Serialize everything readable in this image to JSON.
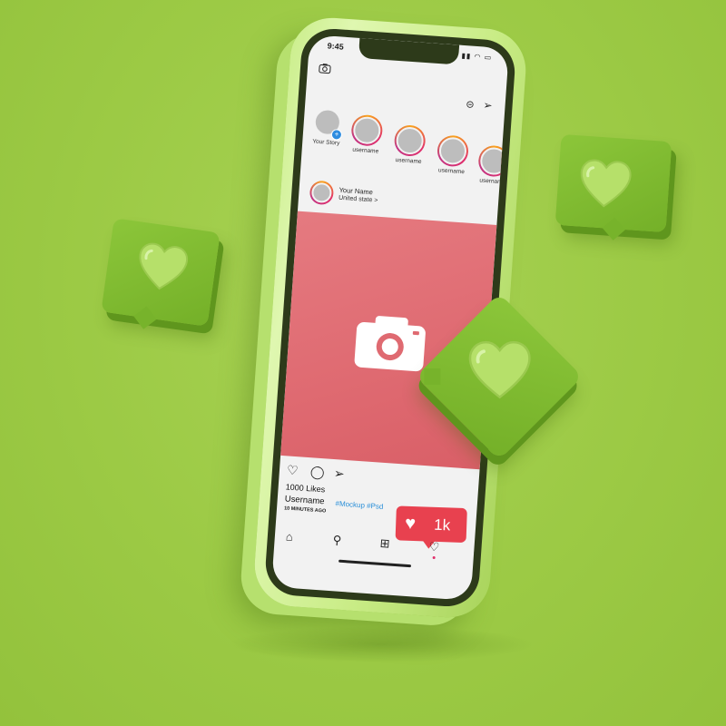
{
  "status_bar": {
    "time": "9:45",
    "icons": "▮▮ ◠ ▭"
  },
  "stories": [
    {
      "label": "Your Story",
      "is_own": true
    },
    {
      "label": "username"
    },
    {
      "label": "username"
    },
    {
      "label": "username"
    },
    {
      "label": "username"
    }
  ],
  "post": {
    "name": "Your Name",
    "location": "United state  >",
    "more": "...",
    "likes": "1000 Likes",
    "username": "Username",
    "tags": "#Mockup #Psd",
    "time_ago": "10 MINUTES AGO"
  },
  "like_badge": {
    "count": "1k"
  },
  "icons": {
    "header": [
      "camera-icon",
      "igtv-icon",
      "send-icon"
    ],
    "actions": [
      "heart-icon",
      "comment-icon",
      "share-icon",
      "bookmark-icon"
    ],
    "bottom_nav": [
      "home-icon",
      "search-icon",
      "add-post-icon",
      "activity-heart-icon",
      "profile-icon"
    ]
  },
  "colors": {
    "background": "#9cca45",
    "phone_body": "#cbee8c",
    "post_image": "#df6a71",
    "like_badge": "#e8414f",
    "bubble": "#7eb930",
    "heart": "#b6e06a",
    "tag_link": "#2a8fd8"
  }
}
